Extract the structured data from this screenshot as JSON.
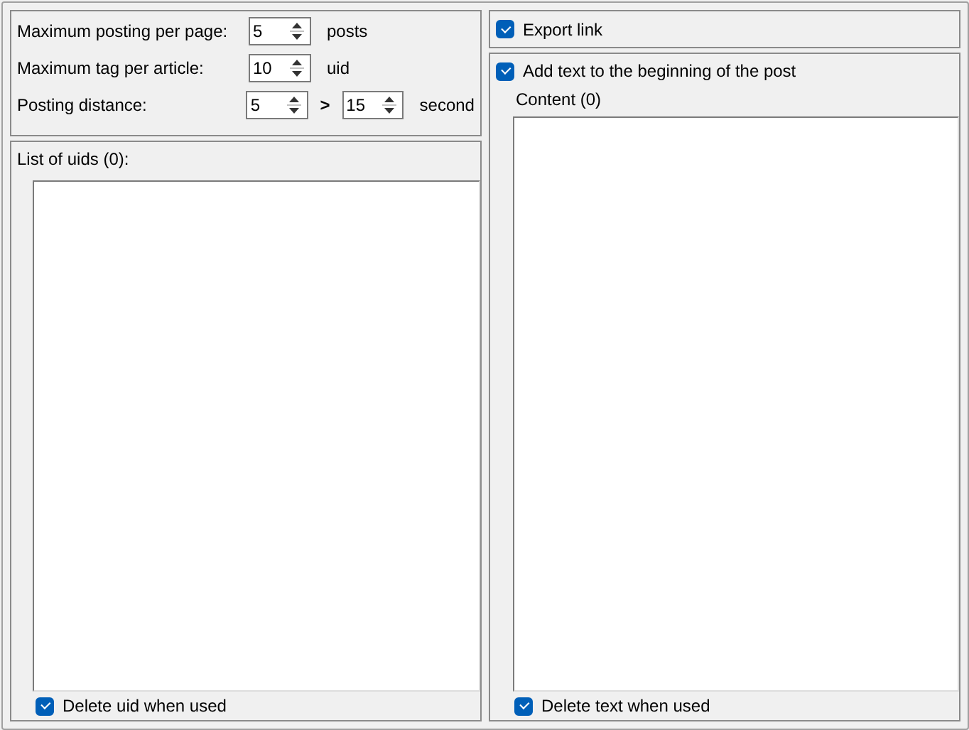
{
  "settings": [
    {
      "label": "Maximum posting per page:",
      "fields": [
        "5"
      ],
      "unit": "posts"
    },
    {
      "label": "Maximum tag per article:",
      "fields": [
        "10"
      ],
      "unit": "uid"
    },
    {
      "label": "Posting distance:",
      "fields": [
        "5",
        "15"
      ],
      "separator": ">",
      "unit": "second"
    }
  ],
  "uid_list": {
    "label": "List of uids (0):",
    "delete_option": {
      "label": "Delete uid when used",
      "checked": true
    }
  },
  "export_link": {
    "label": "Export link",
    "checked": true
  },
  "add_text": {
    "label": "Add text to the beginning of the post",
    "checked": true,
    "content_label": "Content (0)",
    "delete_option": {
      "label": "Delete text when used",
      "checked": true
    }
  }
}
